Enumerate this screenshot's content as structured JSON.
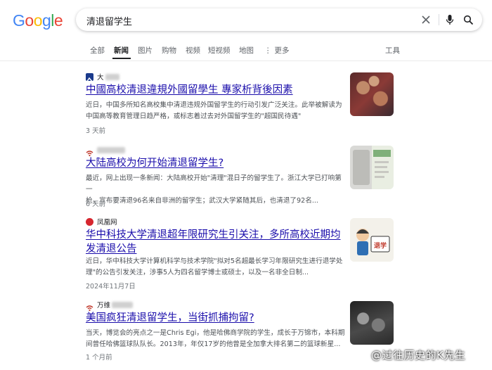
{
  "logo": {
    "letters": [
      "G",
      "o",
      "o",
      "g",
      "l",
      "e"
    ],
    "colors": [
      "#4285F4",
      "#EA4335",
      "#FBBC05",
      "#4285F4",
      "#34A853",
      "#EA4335"
    ]
  },
  "search": {
    "query": "清退留学生"
  },
  "tabs": [
    {
      "label": "全部",
      "active": false
    },
    {
      "label": "新闻",
      "active": true
    },
    {
      "label": "图片",
      "active": false
    },
    {
      "label": "购物",
      "active": false
    },
    {
      "label": "视频",
      "active": false
    },
    {
      "label": "短视频",
      "active": false
    },
    {
      "label": "地图",
      "active": false
    },
    {
      "label": "更多",
      "active": false
    }
  ],
  "tools_label": "工具",
  "results": [
    {
      "source": "大",
      "title": "中國高校清退違規外國留學生 專家析背後因素",
      "snippet": [
        "近日，中国多所知名高校集中清退违规外国留学生的行动引发广泛关注。此举被解读为",
        "中国高等教育管理日趋严格，或标志着过去对外国留学生的\"超国民待遇\""
      ],
      "date": "3 天前"
    },
    {
      "source": "",
      "title": "大陆高校为何开始清退留学生?",
      "snippet": [
        "最近，网上出现一条新闻：大陆高校开始\"清理\"混日子的留学生了。浙江大学已打响第一",
        "枪，宣布要清退96名来自非洲的留学生；武汉大学紧随其后，也清退了92名..."
      ],
      "date": "6 天前"
    },
    {
      "source": "凤凰网",
      "title": "华中科技大学清退超年限研究生引关注，多所高校近期均发清退公告",
      "snippet": [
        "近日，华中科技大学计算机科学与技术学院\"拟对5名超最长学习年限研究生进行退学处",
        "理\"的公告引发关注，涉事5人为四名留学博士或硕士，以及一名非全日制..."
      ],
      "date": "2024年11月7日"
    },
    {
      "source": "万维",
      "title": "美国疯狂清退留学生，当街抓捕拘留?",
      "snippet": [
        "当天，博览会的亮点之一是Chris Egi，他是哈佛商学院的学生，成长于万锦市，本科期",
        "间曾任哈佛篮球队队长。2013年，年仅17岁的他曾是全加拿大排名第二的篮球新星..."
      ],
      "date": "1 个月前"
    }
  ],
  "watermark": "@过往历史的K先生"
}
